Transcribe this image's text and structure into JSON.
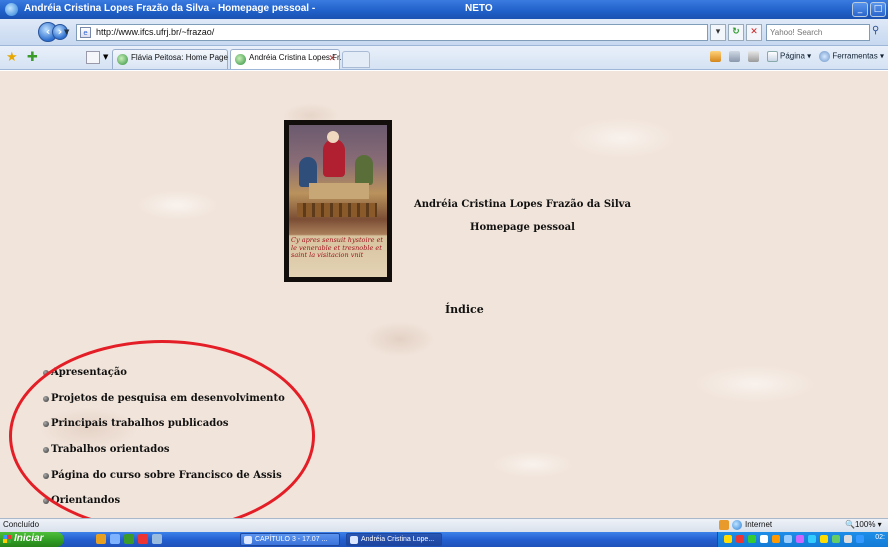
{
  "window": {
    "title": "Andréia Cristina Lopes Frazão da Silva - Homepage pessoal -",
    "title_suffix": "NETO",
    "controls": [
      "_",
      "□"
    ]
  },
  "address_bar": {
    "url": "http://www.ifcs.ufrj.br/~frazao/",
    "search_placeholder": "Yahoo! Search"
  },
  "tabs": [
    {
      "label": "Flávia Peitosa: Home Page P...",
      "active": false
    },
    {
      "label": "Andréia Cristina Lopes Fr...",
      "active": true
    }
  ],
  "command_bar": {
    "page_label": "Página",
    "tools_label": "Ferramentas"
  },
  "page": {
    "picture_caption": "Cy apres sensuit hystoire et le venerable et tresnoble et saint la visitacion vnit",
    "name": "Andréia Cristina Lopes Frazão da Silva",
    "subtitle": "Homepage pessoal",
    "index_heading": "Índice",
    "menu": [
      "Apresentação",
      "Projetos de pesquisa em desenvolvimento",
      "Principais trabalhos publicados",
      "Trabalhos orientados",
      "Página do curso sobre Francisco de Assis",
      "Orientandos"
    ],
    "highlight_color": "#e41e26"
  },
  "status_bar": {
    "status": "Concluído",
    "zone": "Internet",
    "zoom": "100%"
  },
  "taskbar": {
    "start_label": "Iniciar",
    "items": [
      {
        "label": "CAPÍTULO 3 - 17.07 ...",
        "active": false
      },
      {
        "label": "Andréia Cristina Lope...",
        "active": true
      }
    ],
    "clock": "02:"
  }
}
